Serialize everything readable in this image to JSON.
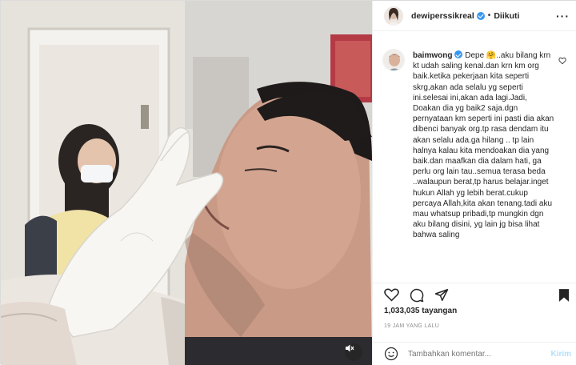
{
  "header": {
    "username": "dewiperssikreal",
    "separator": "•",
    "follow_status": "Diikuti",
    "more_icon": "more-horizontal-icon"
  },
  "comment": {
    "author": "baimwong",
    "emoji": "🤗",
    "text_start": " Depe ",
    "text_rest": "..aku bilang krn kt udah saling kenal.dan krn km org baik.ketika pekerjaan kita seperti skrg,akan ada selalu yg seperti ini.selesai ini,akan ada lagi.Jadi, Doakan dia yg baik2 saja.dgn pernyataan km seperti ini pasti dia akan dibenci banyak org.tp rasa dendam itu akan selalu ada.ga hilang .. tp lain halnya kalau kita mendoakan dia yang baik.dan maafkan dia dalam hati, ga perlu org lain tau..semua terasa beda ..walaupun berat,tp harus belajar.inget hukun Allah yg lebih berat.cukup percaya Allah,kita akan tenang.tadi aku mau whatsup pribadi,tp mungkin dgn aku bilang disini, yg lain jg bisa lihat bahwa saling"
  },
  "stats": {
    "views_count": "1,033,035",
    "views_label": "tayangan",
    "time_ago": "19 JAM YANG LALU"
  },
  "add_comment": {
    "placeholder": "Tambahkan komentar...",
    "send_label": "Kirim"
  },
  "icons": {
    "like": "heart-icon",
    "comment": "comment-icon",
    "share": "send-icon",
    "save": "bookmark-icon",
    "emoji": "emoji-icon",
    "mute": "speaker-muted-icon"
  },
  "colors": {
    "verified": "#3897f0",
    "send_disabled": "#b2dffc",
    "muted_text": "#8e8e8e"
  }
}
